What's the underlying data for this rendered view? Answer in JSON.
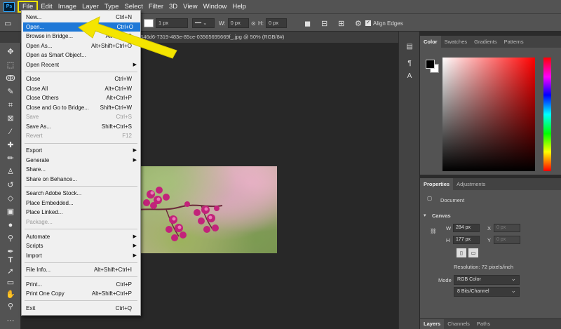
{
  "menubar": {
    "logo": "Ps",
    "items": [
      "File",
      "Edit",
      "Image",
      "Layer",
      "Type",
      "Select",
      "Filter",
      "3D",
      "View",
      "Window",
      "Help"
    ]
  },
  "options": {
    "stroke_width": "1 px",
    "w_label": "W:",
    "w_value": "0 px",
    "h_label": "H:",
    "h_value": "0 px",
    "align_edges": "Align Edges"
  },
  "document": {
    "tab_title": "d646d6-7319-483e-85ce-03565695669f_.jpg @ 50% (RGB/8#)"
  },
  "file_menu": {
    "items": [
      {
        "label": "New...",
        "shortcut": "Ctrl+N"
      },
      {
        "label": "Open...",
        "shortcut": "Ctrl+O"
      },
      {
        "label": "Browse in Bridge...",
        "shortcut": "Alt+Ctrl+O"
      },
      {
        "label": "Open As...",
        "shortcut": "Alt+Shift+Ctrl+O"
      },
      {
        "label": "Open as Smart Object...",
        "shortcut": ""
      },
      {
        "label": "Open Recent",
        "shortcut": ""
      },
      {
        "label": "Close",
        "shortcut": "Ctrl+W"
      },
      {
        "label": "Close All",
        "shortcut": "Alt+Ctrl+W"
      },
      {
        "label": "Close Others",
        "shortcut": "Alt+Ctrl+P"
      },
      {
        "label": "Close and Go to Bridge...",
        "shortcut": "Shift+Ctrl+W"
      },
      {
        "label": "Save",
        "shortcut": "Ctrl+S"
      },
      {
        "label": "Save As...",
        "shortcut": "Shift+Ctrl+S"
      },
      {
        "label": "Revert",
        "shortcut": "F12"
      },
      {
        "label": "Export",
        "shortcut": ""
      },
      {
        "label": "Generate",
        "shortcut": ""
      },
      {
        "label": "Share...",
        "shortcut": ""
      },
      {
        "label": "Share on Behance...",
        "shortcut": ""
      },
      {
        "label": "Search Adobe Stock...",
        "shortcut": ""
      },
      {
        "label": "Place Embedded...",
        "shortcut": ""
      },
      {
        "label": "Place Linked...",
        "shortcut": ""
      },
      {
        "label": "Package...",
        "shortcut": ""
      },
      {
        "label": "Automate",
        "shortcut": ""
      },
      {
        "label": "Scripts",
        "shortcut": ""
      },
      {
        "label": "Import",
        "shortcut": ""
      },
      {
        "label": "File Info...",
        "shortcut": "Alt+Shift+Ctrl+I"
      },
      {
        "label": "Print...",
        "shortcut": "Ctrl+P"
      },
      {
        "label": "Print One Copy",
        "shortcut": "Alt+Shift+Ctrl+P"
      },
      {
        "label": "Exit",
        "shortcut": "Ctrl+Q"
      }
    ]
  },
  "color_panel": {
    "tabs": [
      "Color",
      "Swatches",
      "Gradients",
      "Patterns"
    ],
    "foreground": "#000000",
    "background": "#ffffff"
  },
  "properties_panel": {
    "tabs": [
      "Properties",
      "Adjustments"
    ],
    "doc_label": "Document",
    "section": "Canvas",
    "w_label": "W",
    "w_value": "284 px",
    "x_label": "X",
    "x_value": "0 px",
    "h_label": "H",
    "h_value": "177 px",
    "y_label": "Y",
    "y_value": "0 px",
    "resolution": "Resolution: 72 pixels/inch",
    "mode_label": "Mode",
    "mode_value": "RGB Color",
    "depth_value": "8 Bits/Channel"
  },
  "layers_panel": {
    "tabs": [
      "Layers",
      "Channels",
      "Paths"
    ]
  },
  "accent": {
    "highlight": "#1e78d7",
    "annotation": "#f4e500"
  }
}
